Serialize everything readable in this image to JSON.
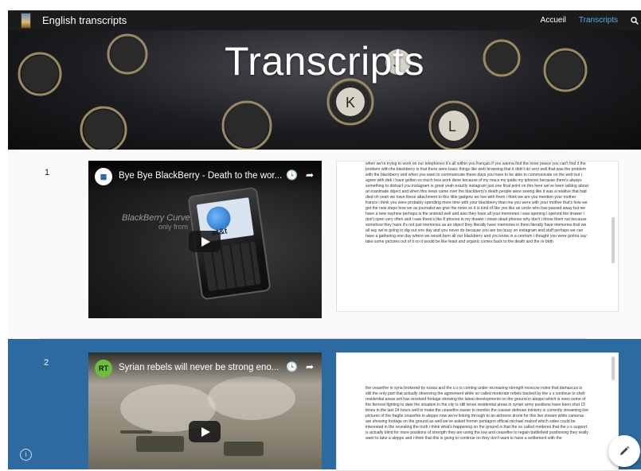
{
  "navbar": {
    "brand": "English transcripts",
    "links": [
      "Accueil",
      "Transcripts"
    ],
    "active_link": "Transcripts"
  },
  "hero": {
    "title": "Transcripts"
  },
  "colors": {
    "navbar_bg": "#1b1b1b",
    "active_link": "#5aaee8",
    "row2_bg": "#2d6a9f"
  },
  "entries": [
    {
      "number": "1",
      "video": {
        "channel_icon": "blackberry-channel-icon",
        "title": "Bye Bye BlackBerry - Death to the wor...",
        "overlay_text": "BlackBerry Curve",
        "overlay_sub": "only from",
        "phone_logo": "at&t"
      },
      "transcript": "when we're trying to work on our telephones it's all within you français if you wanna find the inner peace you can't find it the problem with the blackberry is that there were basic things like web browsing that it didn't do very well that was the problem with the blackberry and when you want to communicate these days you have to be able to communicate on the web but i agree with deb i have gotten so much less work done because of my macs my ipads my iphones because there's always something to distract you instagram is great yeah exactly instagram just one final point on this here we've been talking about an inanimate object and when this news came over the blackberry's death people were seeing like it was a relative that had died oh yeah we have these attachment to this little gadgets we live with them i think we are you mention your mother francis i think you were probably spending more time with your blackberry than me you were with your mother that's how we get the new steps how we as journalist we give the news so it is kind of like yes like an uncle who has passed away but we have a new nephew perhaps is the android well and also they have all your memories i was opening i opened the drawer i don't open very often and i saw there's like 8 phones in my drawer i mean dead phones why don't i throw them out because somehow they have it's not just memories as an object they literally have memories in them literally have memories that we all say we're going to dig out one day and you never do because you are too busy on instagram and stuff perhaps we can have a gathering one day where we would burn all our blackberry and you know in a centrum i thought you were gonna say: take some pictures out of it no it would be like feast and organic comes back to the death and the re birth"
    },
    {
      "number": "2",
      "video": {
        "channel_icon": "rt-channel-icon",
        "channel_badge": "RT",
        "title": "Syrian rebels will never be strong eno..."
      },
      "transcript": "the ceasefire in syria brokered by russia and the u s is coming under increasing strength moscow notes that damascus is still the only part that actually observing the agreement while so called moderate rebels backed by the u s continue to shell residential areas arti has received footage showing the latest developments on the ground in aleppo which is seen some of the fiercest fighting to date the situation in the city is still tense residential areas in syrian army positions have been shot 15 times in the last 24 hours well to make the ceasefire easier to monitor the russian defense ministry is currently streaming live pictures of the fragile ceasefire in aleppo now we're linking through to an airborne drone for this live stream while cameras are showing footage on the ground as well we've asked former pentagon official michael maloof which sides could be interested in the revealing the truth i think what's happening on the ground is that the so called moderes that the u s support is actually blind for more positions of strength they are using the low and ceasefire to regain battlefield positioning they really want to take a aleppo and i think that this is going to continue on they don't want to have a settlement with the"
    }
  ],
  "icons": {
    "search": "search-icon",
    "clock": "watch-later-icon",
    "share": "share-icon",
    "play": "play-icon",
    "info": "info-icon",
    "edit": "pencil-icon"
  }
}
